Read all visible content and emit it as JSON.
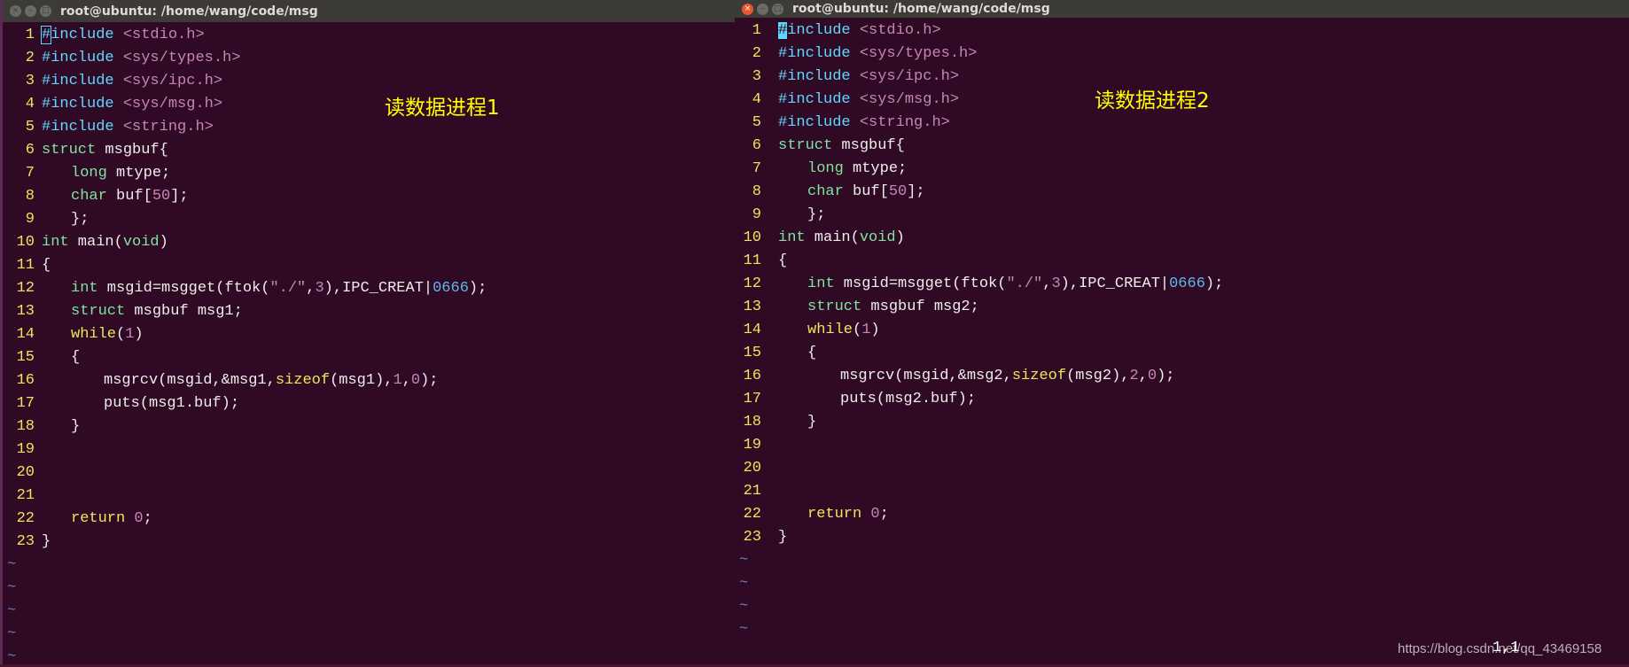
{
  "colors": {
    "background": "#300a24",
    "line_number": "#e8e85a",
    "preproc": "#5fd7ff",
    "string": "#c387b5",
    "type_keyword": "#7fe3a0",
    "statement": "#e8e85a",
    "label": "#ffff00"
  },
  "windows": [
    {
      "title": "root@ubuntu: /home/wang/code/msg",
      "label": "读数据进程1",
      "cursor_style": "outline",
      "tilde_count": 5,
      "lines": [
        {
          "num": "1",
          "indent": 0,
          "tokens": [
            {
              "c": "pp",
              "t": "#include"
            },
            {
              "c": "str",
              "t": " <stdio.h>"
            }
          ]
        },
        {
          "num": "2",
          "indent": 0,
          "tokens": [
            {
              "c": "pp",
              "t": "#include"
            },
            {
              "c": "str",
              "t": " <sys/types.h>"
            }
          ]
        },
        {
          "num": "3",
          "indent": 0,
          "tokens": [
            {
              "c": "pp",
              "t": "#include"
            },
            {
              "c": "str",
              "t": " <sys/ipc.h>"
            }
          ]
        },
        {
          "num": "4",
          "indent": 0,
          "tokens": [
            {
              "c": "pp",
              "t": "#include"
            },
            {
              "c": "str",
              "t": " <sys/msg.h>"
            }
          ]
        },
        {
          "num": "5",
          "indent": 0,
          "tokens": [
            {
              "c": "pp",
              "t": "#include"
            },
            {
              "c": "str",
              "t": " <string.h>"
            }
          ]
        },
        {
          "num": "6",
          "indent": 0,
          "tokens": [
            {
              "c": "kw",
              "t": "struct"
            },
            {
              "c": "n",
              "t": " msgbuf{"
            }
          ]
        },
        {
          "num": "7",
          "indent": 1,
          "tokens": [
            {
              "c": "kw",
              "t": "long"
            },
            {
              "c": "n",
              "t": " mtype;"
            }
          ]
        },
        {
          "num": "8",
          "indent": 1,
          "tokens": [
            {
              "c": "kw",
              "t": "char"
            },
            {
              "c": "n",
              "t": " buf["
            },
            {
              "c": "num",
              "t": "50"
            },
            {
              "c": "n",
              "t": "];"
            }
          ]
        },
        {
          "num": "9",
          "indent": 1,
          "tokens": [
            {
              "c": "n",
              "t": "};"
            }
          ]
        },
        {
          "num": "10",
          "indent": 0,
          "tokens": [
            {
              "c": "kw",
              "t": "int"
            },
            {
              "c": "n",
              "t": " main("
            },
            {
              "c": "kw",
              "t": "void"
            },
            {
              "c": "n",
              "t": ")"
            }
          ]
        },
        {
          "num": "11",
          "indent": 0,
          "tokens": [
            {
              "c": "n",
              "t": "{"
            }
          ]
        },
        {
          "num": "12",
          "indent": 1,
          "tokens": [
            {
              "c": "kw",
              "t": "int"
            },
            {
              "c": "n",
              "t": " msgid=msgget(ftok("
            },
            {
              "c": "str",
              "t": "\"./\""
            },
            {
              "c": "n",
              "t": ","
            },
            {
              "c": "num",
              "t": "3"
            },
            {
              "c": "n",
              "t": "),IPC_CREAT|"
            },
            {
              "c": "oct",
              "t": "0666"
            },
            {
              "c": "n",
              "t": ");"
            }
          ]
        },
        {
          "num": "13",
          "indent": 1,
          "tokens": [
            {
              "c": "kw",
              "t": "struct"
            },
            {
              "c": "n",
              "t": " msgbuf msg1;"
            }
          ]
        },
        {
          "num": "14",
          "indent": 1,
          "tokens": [
            {
              "c": "st",
              "t": "while"
            },
            {
              "c": "n",
              "t": "("
            },
            {
              "c": "num",
              "t": "1"
            },
            {
              "c": "n",
              "t": ")"
            }
          ]
        },
        {
          "num": "15",
          "indent": 1,
          "tokens": [
            {
              "c": "n",
              "t": "{"
            }
          ]
        },
        {
          "num": "16",
          "indent": 2,
          "tokens": [
            {
              "c": "n",
              "t": "msgrcv(msgid,&msg1,"
            },
            {
              "c": "st",
              "t": "sizeof"
            },
            {
              "c": "n",
              "t": "(msg1),"
            },
            {
              "c": "num",
              "t": "1"
            },
            {
              "c": "n",
              "t": ","
            },
            {
              "c": "num",
              "t": "0"
            },
            {
              "c": "n",
              "t": ");"
            }
          ]
        },
        {
          "num": "17",
          "indent": 2,
          "tokens": [
            {
              "c": "n",
              "t": "puts(msg1.buf);"
            }
          ]
        },
        {
          "num": "18",
          "indent": 1,
          "tokens": [
            {
              "c": "n",
              "t": "}"
            }
          ]
        },
        {
          "num": "19",
          "indent": 0,
          "tokens": []
        },
        {
          "num": "20",
          "indent": 0,
          "tokens": []
        },
        {
          "num": "21",
          "indent": 0,
          "tokens": []
        },
        {
          "num": "22",
          "indent": 1,
          "tokens": [
            {
              "c": "st",
              "t": "return"
            },
            {
              "c": "n",
              "t": " "
            },
            {
              "c": "num",
              "t": "0"
            },
            {
              "c": "n",
              "t": ";"
            }
          ]
        },
        {
          "num": "23",
          "indent": 0,
          "tokens": [
            {
              "c": "n",
              "t": "}"
            }
          ]
        }
      ]
    },
    {
      "title": "root@ubuntu: /home/wang/code/msg",
      "label": "读数据进程2",
      "cursor_style": "block",
      "tilde_count": 4,
      "status": "1,1",
      "lines": [
        {
          "num": "1",
          "indent": 0,
          "tokens": [
            {
              "c": "pp",
              "t": "#include"
            },
            {
              "c": "str",
              "t": " <stdio.h>"
            }
          ]
        },
        {
          "num": "2",
          "indent": 0,
          "tokens": [
            {
              "c": "pp",
              "t": "#include"
            },
            {
              "c": "str",
              "t": " <sys/types.h>"
            }
          ]
        },
        {
          "num": "3",
          "indent": 0,
          "tokens": [
            {
              "c": "pp",
              "t": "#include"
            },
            {
              "c": "str",
              "t": " <sys/ipc.h>"
            }
          ]
        },
        {
          "num": "4",
          "indent": 0,
          "tokens": [
            {
              "c": "pp",
              "t": "#include"
            },
            {
              "c": "str",
              "t": " <sys/msg.h>"
            }
          ]
        },
        {
          "num": "5",
          "indent": 0,
          "tokens": [
            {
              "c": "pp",
              "t": "#include"
            },
            {
              "c": "str",
              "t": " <string.h>"
            }
          ]
        },
        {
          "num": "6",
          "indent": 0,
          "tokens": [
            {
              "c": "kw",
              "t": "struct"
            },
            {
              "c": "n",
              "t": " msgbuf{"
            }
          ]
        },
        {
          "num": "7",
          "indent": 1,
          "tokens": [
            {
              "c": "kw",
              "t": "long"
            },
            {
              "c": "n",
              "t": " mtype;"
            }
          ]
        },
        {
          "num": "8",
          "indent": 1,
          "tokens": [
            {
              "c": "kw",
              "t": "char"
            },
            {
              "c": "n",
              "t": " buf["
            },
            {
              "c": "num",
              "t": "50"
            },
            {
              "c": "n",
              "t": "];"
            }
          ]
        },
        {
          "num": "9",
          "indent": 1,
          "tokens": [
            {
              "c": "n",
              "t": "};"
            }
          ]
        },
        {
          "num": "10",
          "indent": 0,
          "tokens": [
            {
              "c": "kw",
              "t": "int"
            },
            {
              "c": "n",
              "t": " main("
            },
            {
              "c": "kw",
              "t": "void"
            },
            {
              "c": "n",
              "t": ")"
            }
          ]
        },
        {
          "num": "11",
          "indent": 0,
          "tokens": [
            {
              "c": "n",
              "t": "{"
            }
          ]
        },
        {
          "num": "12",
          "indent": 1,
          "tokens": [
            {
              "c": "kw",
              "t": "int"
            },
            {
              "c": "n",
              "t": " msgid=msgget(ftok("
            },
            {
              "c": "str",
              "t": "\"./\""
            },
            {
              "c": "n",
              "t": ","
            },
            {
              "c": "num",
              "t": "3"
            },
            {
              "c": "n",
              "t": "),IPC_CREAT|"
            },
            {
              "c": "oct",
              "t": "0666"
            },
            {
              "c": "n",
              "t": ");"
            }
          ]
        },
        {
          "num": "13",
          "indent": 1,
          "tokens": [
            {
              "c": "kw",
              "t": "struct"
            },
            {
              "c": "n",
              "t": " msgbuf msg2;"
            }
          ]
        },
        {
          "num": "14",
          "indent": 1,
          "tokens": [
            {
              "c": "st",
              "t": "while"
            },
            {
              "c": "n",
              "t": "("
            },
            {
              "c": "num",
              "t": "1"
            },
            {
              "c": "n",
              "t": ")"
            }
          ]
        },
        {
          "num": "15",
          "indent": 1,
          "tokens": [
            {
              "c": "n",
              "t": "{"
            }
          ]
        },
        {
          "num": "16",
          "indent": 2,
          "tokens": [
            {
              "c": "n",
              "t": "msgrcv(msgid,&msg2,"
            },
            {
              "c": "st",
              "t": "sizeof"
            },
            {
              "c": "n",
              "t": "(msg2),"
            },
            {
              "c": "num",
              "t": "2"
            },
            {
              "c": "n",
              "t": ","
            },
            {
              "c": "num",
              "t": "0"
            },
            {
              "c": "n",
              "t": ");"
            }
          ]
        },
        {
          "num": "17",
          "indent": 2,
          "tokens": [
            {
              "c": "n",
              "t": "puts(msg2.buf);"
            }
          ]
        },
        {
          "num": "18",
          "indent": 1,
          "tokens": [
            {
              "c": "n",
              "t": "}"
            }
          ]
        },
        {
          "num": "19",
          "indent": 0,
          "tokens": []
        },
        {
          "num": "20",
          "indent": 0,
          "tokens": []
        },
        {
          "num": "21",
          "indent": 0,
          "tokens": []
        },
        {
          "num": "22",
          "indent": 1,
          "tokens": [
            {
              "c": "st",
              "t": "return"
            },
            {
              "c": "n",
              "t": " "
            },
            {
              "c": "num",
              "t": "0"
            },
            {
              "c": "n",
              "t": ";"
            }
          ]
        },
        {
          "num": "23",
          "indent": 0,
          "tokens": [
            {
              "c": "n",
              "t": "}"
            }
          ]
        }
      ]
    }
  ],
  "watermark": "https://blog.csdn.net/qq_43469158"
}
